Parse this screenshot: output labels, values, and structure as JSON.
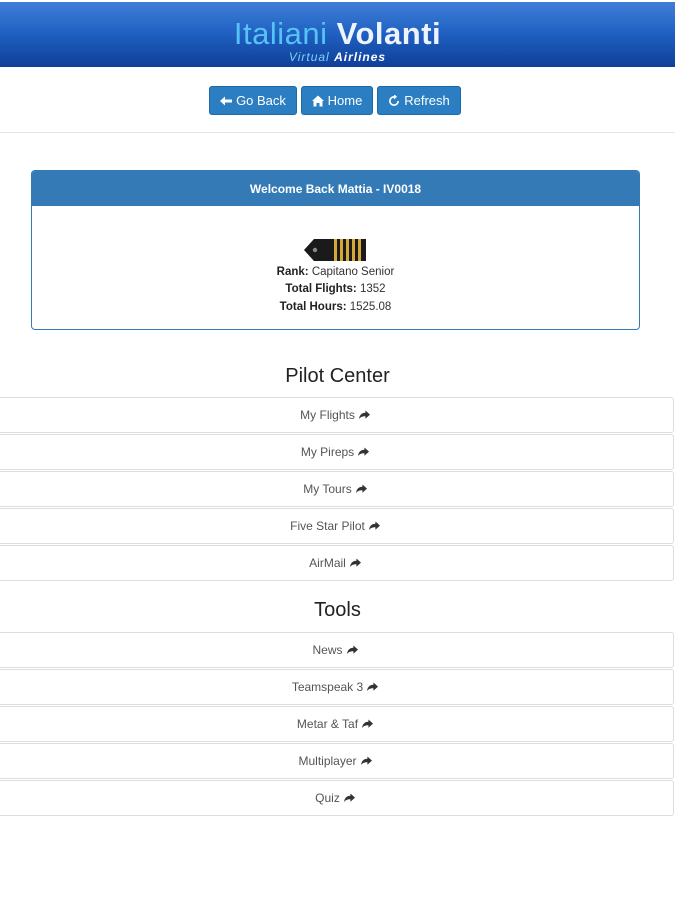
{
  "header": {
    "logo_word1": "Italiani",
    "logo_word2": "Volanti",
    "logo_sub1": "Virtual",
    "logo_sub2": "Airlines"
  },
  "nav": {
    "go_back": "Go Back",
    "home": "Home",
    "refresh": "Refresh"
  },
  "welcome": {
    "title": "Welcome Back Mattia - IV0018",
    "rank_label": "Rank:",
    "rank_value": "Capitano Senior",
    "flights_label": "Total Flights:",
    "flights_value": "1352",
    "hours_label": "Total Hours:",
    "hours_value": "1525.08"
  },
  "pilot_center": {
    "title": "Pilot Center",
    "items": [
      "My Flights",
      "My Pireps",
      "My Tours",
      "Five Star Pilot",
      "AirMail"
    ]
  },
  "tools": {
    "title": "Tools",
    "items": [
      "News",
      "Teamspeak 3",
      "Metar & Taf",
      "Multiplayer",
      "Quiz"
    ]
  },
  "colors": {
    "primary": "#337ab7",
    "button": "#2a7ec1",
    "header_top": "#3f7fd9",
    "header_bottom": "#0f3f9a"
  }
}
